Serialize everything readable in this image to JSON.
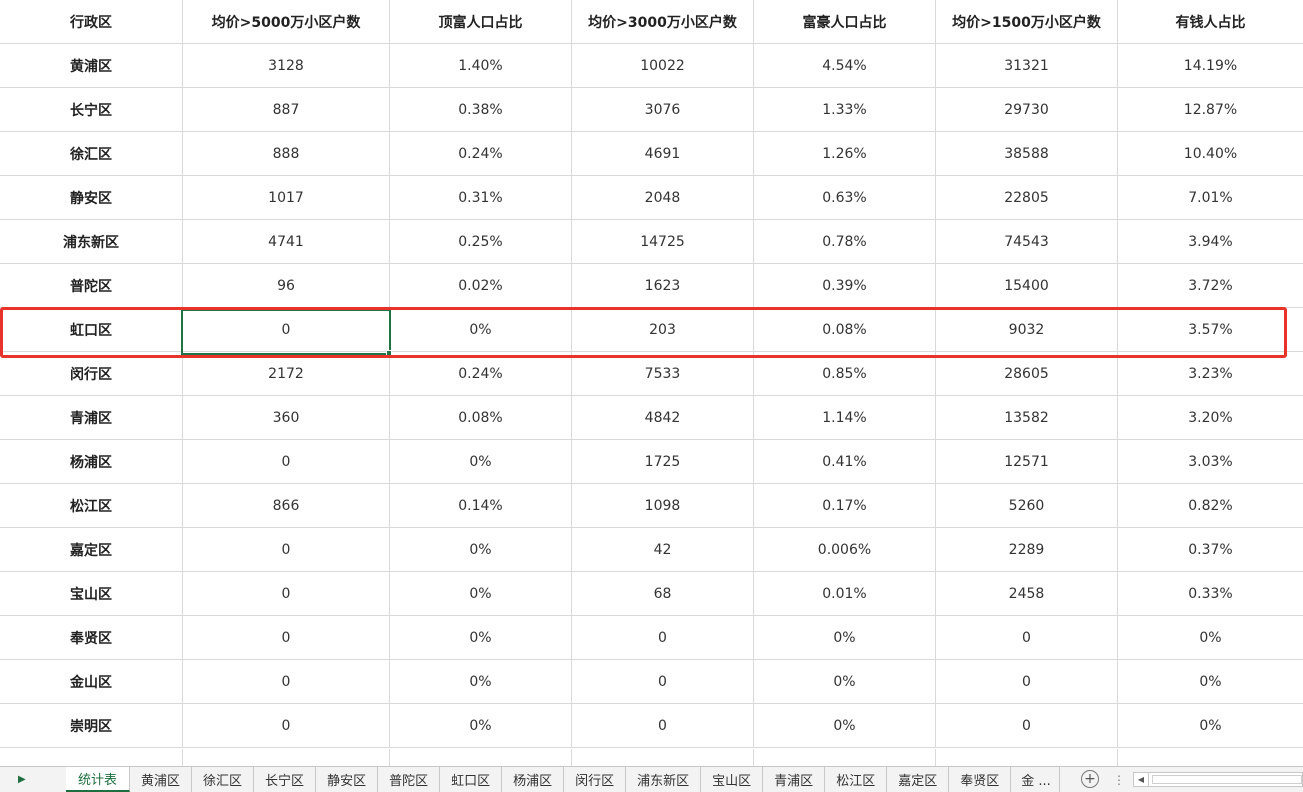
{
  "table": {
    "headers": [
      "行政区",
      "均价>5000万小区户数",
      "顶富人口占比",
      "均价>3000万小区户数",
      "富豪人口占比",
      "均价>1500万小区户数",
      "有钱人占比"
    ],
    "rows": [
      [
        "黄浦区",
        "3128",
        "1.40%",
        "10022",
        "4.54%",
        "31321",
        "14.19%"
      ],
      [
        "长宁区",
        "887",
        "0.38%",
        "3076",
        "1.33%",
        "29730",
        "12.87%"
      ],
      [
        "徐汇区",
        "888",
        "0.24%",
        "4691",
        "1.26%",
        "38588",
        "10.40%"
      ],
      [
        "静安区",
        "1017",
        "0.31%",
        "2048",
        "0.63%",
        "22805",
        "7.01%"
      ],
      [
        "浦东新区",
        "4741",
        "0.25%",
        "14725",
        "0.78%",
        "74543",
        "3.94%"
      ],
      [
        "普陀区",
        "96",
        "0.02%",
        "1623",
        "0.39%",
        "15400",
        "3.72%"
      ],
      [
        "虹口区",
        "0",
        "0%",
        "203",
        "0.08%",
        "9032",
        "3.57%"
      ],
      [
        "闵行区",
        "2172",
        "0.24%",
        "7533",
        "0.85%",
        "28605",
        "3.23%"
      ],
      [
        "青浦区",
        "360",
        "0.08%",
        "4842",
        "1.14%",
        "13582",
        "3.20%"
      ],
      [
        "杨浦区",
        "0",
        "0%",
        "1725",
        "0.41%",
        "12571",
        "3.03%"
      ],
      [
        "松江区",
        "866",
        "0.14%",
        "1098",
        "0.17%",
        "5260",
        "0.82%"
      ],
      [
        "嘉定区",
        "0",
        "0%",
        "42",
        "0.006%",
        "2289",
        "0.37%"
      ],
      [
        "宝山区",
        "0",
        "0%",
        "68",
        "0.01%",
        "2458",
        "0.33%"
      ],
      [
        "奉贤区",
        "0",
        "0%",
        "0",
        "0%",
        "0",
        "0%"
      ],
      [
        "金山区",
        "0",
        "0%",
        "0",
        "0%",
        "0",
        "0%"
      ],
      [
        "崇明区",
        "0",
        "0%",
        "0",
        "0%",
        "0",
        "0%"
      ]
    ]
  },
  "highlight": {
    "row_label": "虹口区",
    "color": "#e8332a"
  },
  "selection": {
    "color": "#217346"
  },
  "tabs": [
    "统计表",
    "黄浦区",
    "徐汇区",
    "长宁区",
    "静安区",
    "普陀区",
    "虹口区",
    "杨浦区",
    "闵行区",
    "浦东新区",
    "宝山区",
    "青浦区",
    "松江区",
    "嘉定区",
    "奉贤区",
    "金 ..."
  ],
  "active_tab": "统计表",
  "icons": {
    "nav": "triangle-right-icon",
    "add_sheet": "plus-circle-icon",
    "more": "more-vertical-icon",
    "scroll_left": "triangle-left-icon"
  },
  "symbols": {
    "add_sheet": "+",
    "more": "⋮"
  }
}
